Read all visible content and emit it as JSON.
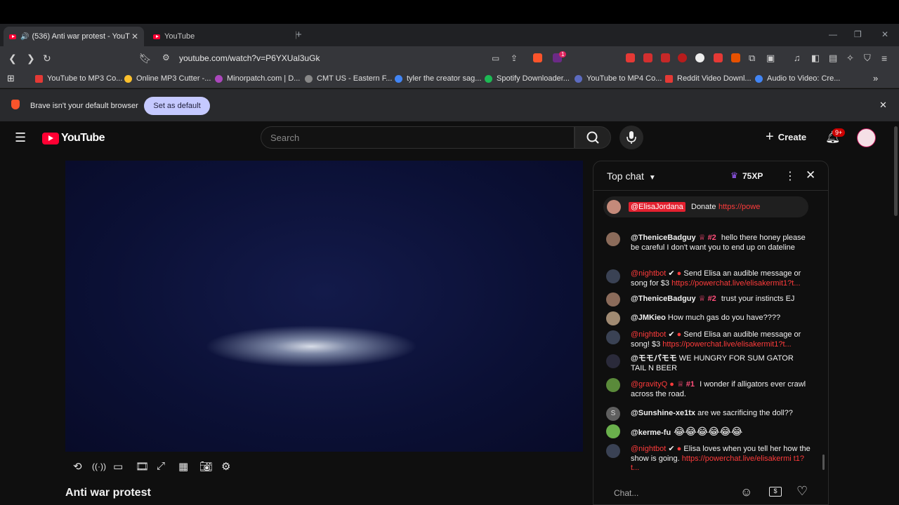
{
  "browser": {
    "tabs": [
      {
        "title": "(536) Anti war protest - YouTu",
        "active": true
      },
      {
        "title": "YouTube",
        "active": false
      }
    ],
    "url": "youtube.com/watch?v=P6YXUal3uGk",
    "bookmarks": [
      "YouTube to MP3 Co...",
      "Online MP3 Cutter -...",
      "Minorpatch.com | D...",
      "CMT US - Eastern F...",
      "tyler the creator sag...",
      "Spotify Downloader...",
      "YouTube to MP4 Co...",
      "Reddit Video Downl...",
      "Audio to Video: Cre..."
    ],
    "default_bar": {
      "message": "Brave isn't your default browser",
      "button": "Set as default"
    },
    "badge_count": "1"
  },
  "youtube": {
    "logo_text": "YouTube",
    "search_placeholder": "Search",
    "create_label": "Create",
    "notifications_badge": "9+",
    "video_title": "Anti war protest"
  },
  "chat": {
    "header": "Top chat",
    "xp": "75XP",
    "pinned": {
      "author": "@ElisaJordana",
      "label": "Donate",
      "link": "https://powe"
    },
    "messages": [
      {
        "author": "@TheniceBadguy",
        "rank": "#2",
        "text": "hello there honey please be careful I don't want you to end up on dateline",
        "link": ""
      },
      {
        "author": "@nightbot",
        "rank": "",
        "text": "Send Elisa an audible message or song for $3",
        "link": "https://powerchat.live/elisakermit1?t..."
      },
      {
        "author": "@TheniceBadguy",
        "rank": "#2",
        "text": "trust your instincts EJ",
        "link": ""
      },
      {
        "author": "@JMKieo",
        "rank": "",
        "text": "How much gas do you have????",
        "link": ""
      },
      {
        "author": "@nightbot",
        "rank": "",
        "text": "Send Elisa an audible message or song! $3",
        "link": "https://powerchat.live/elisakermit1?t..."
      },
      {
        "author": "@モモパモモ",
        "rank": "",
        "text": "WE HUNGRY FOR SUM GATOR TAIL N BEER",
        "link": ""
      },
      {
        "author": "@gravityQ",
        "rank": "#1",
        "text": "I wonder if alligators ever crawl across the road.",
        "link": ""
      },
      {
        "author": "@Sunshine-xe1tx",
        "rank": "",
        "text": "are we sacrificing the doll??",
        "link": ""
      },
      {
        "author": "@kerme-fu",
        "rank": "",
        "text": "😂😂😂😂😂😂",
        "link": ""
      },
      {
        "author": "@nightbot",
        "rank": "",
        "text": "Elisa loves when you tell her how the show is going.",
        "link": "https://powerchat.live/elisakermi t1?t..."
      }
    ],
    "input_placeholder": "Chat..."
  }
}
